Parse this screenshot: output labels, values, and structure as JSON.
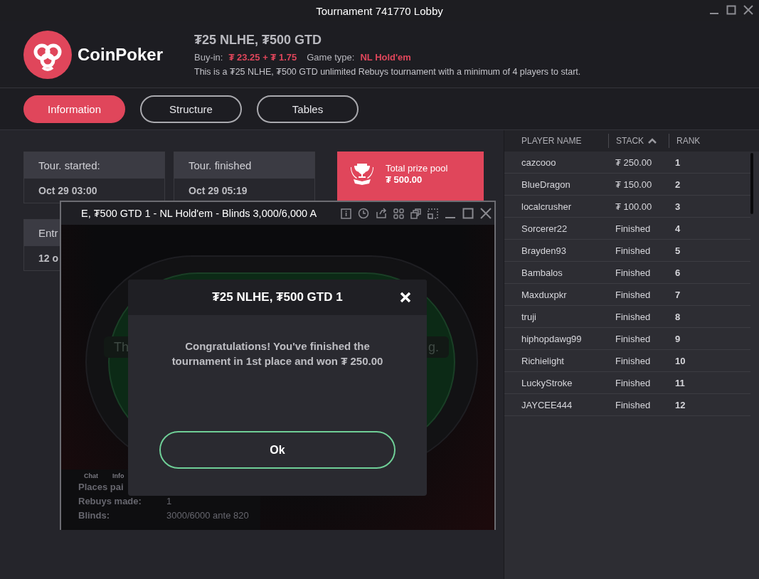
{
  "window": {
    "title": "Tournament 741770 Lobby"
  },
  "header": {
    "brand": "CoinPoker",
    "title": "₮25 NLHE, ₮500 GTD",
    "buy_in_label": "Buy-in:",
    "buy_in": "₮ 23.25 + ₮ 1.75",
    "game_type_label": "Game type:",
    "game_type": "NL Hold'em",
    "description": "This is a ₮25 NLHE, ₮500 GTD unlimited Rebuys tournament with a minimum of 4 players to start."
  },
  "tabs": [
    {
      "label": "Information",
      "selected": true
    },
    {
      "label": "Structure",
      "selected": false
    },
    {
      "label": "Tables",
      "selected": false
    }
  ],
  "info_cards": [
    {
      "label": "Tour. started:",
      "value": "Oct 29 03:00"
    },
    {
      "label": "Tour. finished",
      "value": "Oct 29 05:19"
    },
    {
      "label": "Entr",
      "value": "12 o"
    }
  ],
  "prize_pool": {
    "label": "Total prize pool",
    "amount": "₮ 500.00"
  },
  "players": {
    "columns": [
      {
        "label": "PLAYER NAME",
        "sorted": false
      },
      {
        "label": "STACK",
        "sorted": true
      },
      {
        "label": "RANK",
        "sorted": false
      }
    ],
    "rows": [
      {
        "name": "cazcooo",
        "stack": "₮ 250.00",
        "rank": "1"
      },
      {
        "name": "BlueDragon",
        "stack": "₮ 150.00",
        "rank": "2"
      },
      {
        "name": "localcrusher",
        "stack": "₮ 100.00",
        "rank": "3"
      },
      {
        "name": "Sorcerer22",
        "stack": "Finished",
        "rank": "4"
      },
      {
        "name": "Brayden93",
        "stack": "Finished",
        "rank": "5"
      },
      {
        "name": "Bambalos",
        "stack": "Finished",
        "rank": "6"
      },
      {
        "name": "Maxduxpkr",
        "stack": "Finished",
        "rank": "7"
      },
      {
        "name": "truji",
        "stack": "Finished",
        "rank": "8"
      },
      {
        "name": "hiphopdawg99",
        "stack": "Finished",
        "rank": "9"
      },
      {
        "name": "Richielight",
        "stack": "Finished",
        "rank": "10"
      },
      {
        "name": "LuckyStroke",
        "stack": "Finished",
        "rank": "11"
      },
      {
        "name": "JAYCEE444",
        "stack": "Finished",
        "rank": "12"
      }
    ]
  },
  "table_window": {
    "title": "E, ₮500 GTD 1 - NL Hold'em - Blinds 3,000/6,000 A",
    "table_message": [
      "Th",
      "g."
    ],
    "tabs": [
      "Chat",
      "Info"
    ],
    "stats": [
      {
        "label": "Places pai"
      },
      {
        "label": "Rebuys made:",
        "value": "1"
      },
      {
        "label": "Blinds:",
        "value": "3000/6000 ante 820"
      }
    ]
  },
  "dialog": {
    "title": "₮25 NLHE, ₮500 GTD 1",
    "message": "Congratulations! You've finished the tournament in 1st place and won ₮ 250.00",
    "button": "Ok"
  }
}
